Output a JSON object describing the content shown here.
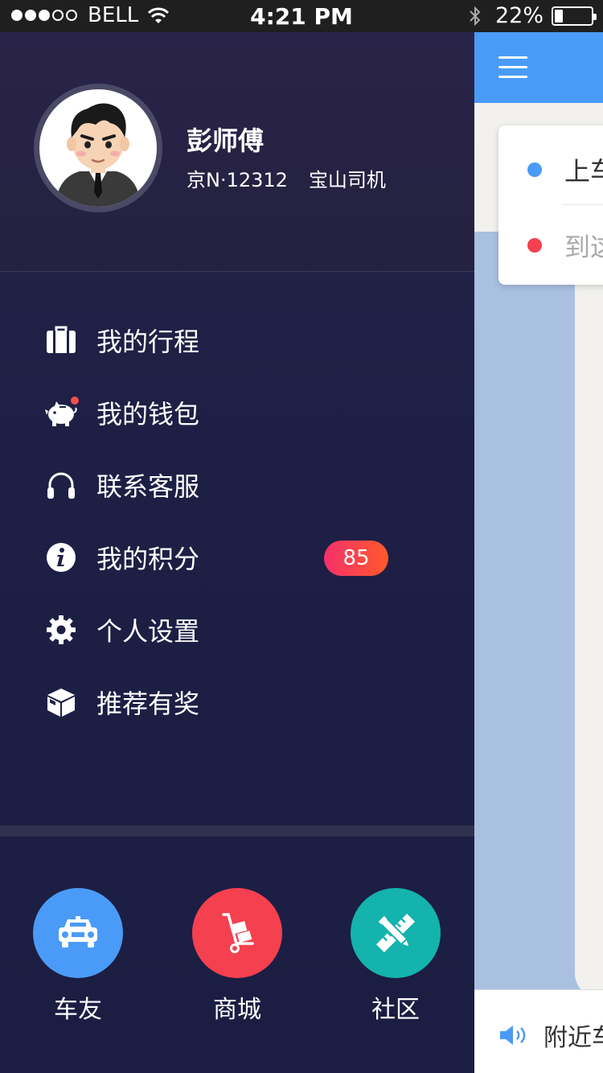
{
  "status_bar": {
    "carrier": "BELL",
    "time": "4:21 PM",
    "battery": "22%",
    "battery_level": 0.22,
    "signal_bars": 3
  },
  "profile": {
    "name": "彭师傅",
    "plate": "京N·12312",
    "role": "宝山司机"
  },
  "menu": [
    {
      "label": "我的行程",
      "icon": "suitcase-icon"
    },
    {
      "label": "我的钱包",
      "icon": "piggy-bank-icon",
      "notify": true
    },
    {
      "label": "联系客服",
      "icon": "headphones-icon"
    },
    {
      "label": "我的积分",
      "icon": "info-icon",
      "badge": "85"
    },
    {
      "label": "个人设置",
      "icon": "gear-icon"
    },
    {
      "label": "推荐有奖",
      "icon": "box-icon"
    }
  ],
  "shortcuts": [
    {
      "label": "车友",
      "icon": "car-icon",
      "color": "#4a9bf7"
    },
    {
      "label": "商城",
      "icon": "cart-icon",
      "color": "#f5404f"
    },
    {
      "label": "社区",
      "icon": "pencil-ruler-icon",
      "color": "#14b3ad"
    }
  ],
  "map_panel": {
    "start_text": "上车",
    "end_text": "到这",
    "nearby_text": "附近车",
    "start_color": "#4a9bf7",
    "end_color": "#f5404f"
  },
  "colors": {
    "accent_blue": "#4a9bf7",
    "badge_gradient_start": "#f5306b",
    "badge_gradient_end": "#ff5a2a"
  }
}
